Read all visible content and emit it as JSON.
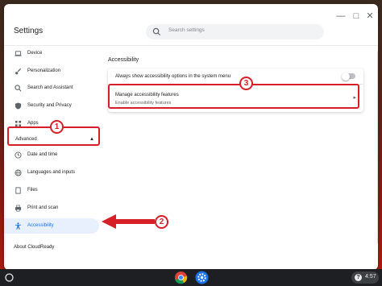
{
  "header": {
    "title": "Settings",
    "search_placeholder": "Search settings"
  },
  "sidebar": {
    "items": [
      {
        "label": "Device",
        "icon": "laptop-icon"
      },
      {
        "label": "Personalization",
        "icon": "brush-icon"
      },
      {
        "label": "Search and Assistant",
        "icon": "search-icon"
      },
      {
        "label": "Security and Privacy",
        "icon": "shield-icon"
      },
      {
        "label": "Apps",
        "icon": "apps-grid-icon"
      },
      {
        "label": "Date and time",
        "icon": "clock-icon"
      },
      {
        "label": "Languages and inputs",
        "icon": "globe-icon"
      },
      {
        "label": "Files",
        "icon": "folder-icon"
      },
      {
        "label": "Print and scan",
        "icon": "printer-icon"
      },
      {
        "label": "Accessibility",
        "icon": "accessibility-icon",
        "active": true
      }
    ],
    "advanced_label": "Advanced",
    "about_label": "About CloudReady"
  },
  "main": {
    "section_title": "Accessibility",
    "toggle_row_label": "Always show accessibility options in the system menu",
    "toggle_on": false,
    "manage_label": "Manage accessibility features",
    "manage_sublabel": "Enable accessibility features"
  },
  "annotations": {
    "badge_1": "1",
    "badge_2": "2",
    "badge_3": "3",
    "color": "#d61f26"
  },
  "taskbar": {
    "time": "4:57",
    "tray_icon": "help-icon"
  },
  "colors": {
    "accent": "#1a73e8",
    "active_bg": "#e8f0fe"
  }
}
